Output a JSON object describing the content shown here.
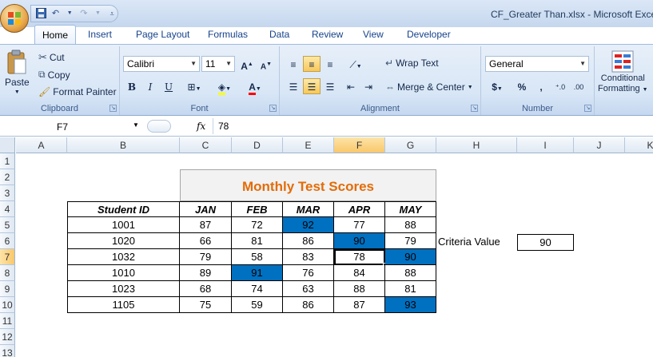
{
  "app": {
    "title": "CF_Greater Than.xlsx - Microsoft Excel"
  },
  "ribbon": {
    "tabs": [
      "Home",
      "Insert",
      "Page Layout",
      "Formulas",
      "Data",
      "Review",
      "View",
      "Developer"
    ],
    "active_tab": "Home",
    "clipboard": {
      "paste": "Paste",
      "cut": "Cut",
      "copy": "Copy",
      "format_painter": "Format Painter",
      "label": "Clipboard"
    },
    "font": {
      "name": "Calibri",
      "size": "11",
      "label": "Font"
    },
    "alignment": {
      "wrap_text": "Wrap Text",
      "merge_center": "Merge & Center",
      "label": "Alignment"
    },
    "number": {
      "format": "General",
      "currency": "$",
      "percent": "%",
      "comma": ",",
      "label": "Number"
    },
    "styles": {
      "conditional_formatting_line1": "Conditional",
      "conditional_formatting_line2": "Formatting"
    }
  },
  "formula_bar": {
    "cell_ref": "F7",
    "fx": "fx",
    "value": "78"
  },
  "sheet": {
    "columns": [
      "A",
      "B",
      "C",
      "D",
      "E",
      "F",
      "G",
      "H",
      "I",
      "J",
      "K"
    ],
    "rows": [
      "1",
      "2",
      "3",
      "4",
      "5",
      "6",
      "7",
      "8",
      "9",
      "10",
      "11",
      "12",
      "13"
    ],
    "selected_column": "F",
    "selected_row": "7",
    "table_title": "Monthly Test Scores",
    "headers": [
      "Student ID",
      "JAN",
      "FEB",
      "MAR",
      "APR",
      "MAY"
    ],
    "data": [
      [
        "1001",
        "87",
        "72",
        "92",
        "77",
        "88"
      ],
      [
        "1020",
        "66",
        "81",
        "86",
        "90",
        "79"
      ],
      [
        "1032",
        "79",
        "58",
        "83",
        "78",
        "90"
      ],
      [
        "1010",
        "89",
        "91",
        "76",
        "84",
        "88"
      ],
      [
        "1023",
        "68",
        "74",
        "63",
        "88",
        "81"
      ],
      [
        "1105",
        "75",
        "59",
        "86",
        "87",
        "93"
      ]
    ],
    "criteria_label": "Criteria Value",
    "criteria_value": "90",
    "highlight_color": "#0070c0",
    "title_color": "#e36c09"
  }
}
